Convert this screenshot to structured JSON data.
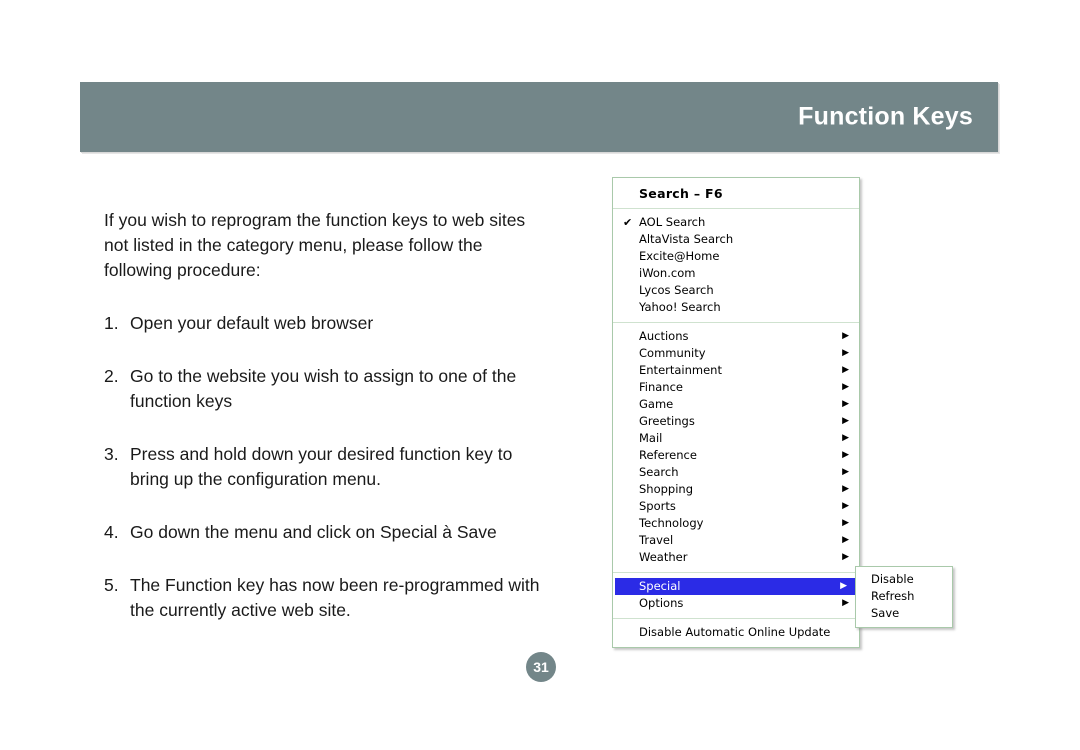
{
  "header": {
    "title": "Function Keys"
  },
  "page": {
    "number": "31"
  },
  "body": {
    "intro": "If you wish to reprogram the function keys to web sites not listed in the category menu, please follow the following procedure:",
    "steps": [
      {
        "num": "1.",
        "text": "Open your default web browser"
      },
      {
        "num": "2.",
        "text": "Go to the website you wish to assign to one of the function keys"
      },
      {
        "num": "3.",
        "text": "Press and hold down your desired function key to bring up the configuration menu."
      },
      {
        "num": "4.",
        "text": "Go down the menu and click on Special à Save"
      },
      {
        "num": "5.",
        "text": "The Function key has now been re-programmed with the currently active web site."
      }
    ]
  },
  "context_menu": {
    "header": "Search – F6",
    "check_glyph": "✔",
    "arrow_glyph": "▶",
    "search_engines": [
      {
        "label": "AOL Search",
        "checked": true
      },
      {
        "label": "AltaVista Search",
        "checked": false
      },
      {
        "label": "Excite@Home",
        "checked": false
      },
      {
        "label": "iWon.com",
        "checked": false
      },
      {
        "label": "Lycos Search",
        "checked": false
      },
      {
        "label": "Yahoo! Search",
        "checked": false
      }
    ],
    "categories": [
      {
        "label": "Auctions"
      },
      {
        "label": "Community"
      },
      {
        "label": "Entertainment"
      },
      {
        "label": "Finance"
      },
      {
        "label": "Game"
      },
      {
        "label": "Greetings"
      },
      {
        "label": "Mail"
      },
      {
        "label": "Reference"
      },
      {
        "label": "Search"
      },
      {
        "label": "Shopping"
      },
      {
        "label": "Sports"
      },
      {
        "label": "Technology"
      },
      {
        "label": "Travel"
      },
      {
        "label": "Weather"
      }
    ],
    "special_group": [
      {
        "label": "Special",
        "selected": true
      },
      {
        "label": "Options",
        "selected": false
      }
    ],
    "footer_item": "Disable Automatic Online Update",
    "submenu": {
      "items": [
        "Disable",
        "Refresh",
        "Save"
      ]
    }
  },
  "colors": {
    "banner": "#738689",
    "highlight": "#2b2be6",
    "menu_border": "#a9c9aa",
    "separator": "#cfe2cf"
  }
}
